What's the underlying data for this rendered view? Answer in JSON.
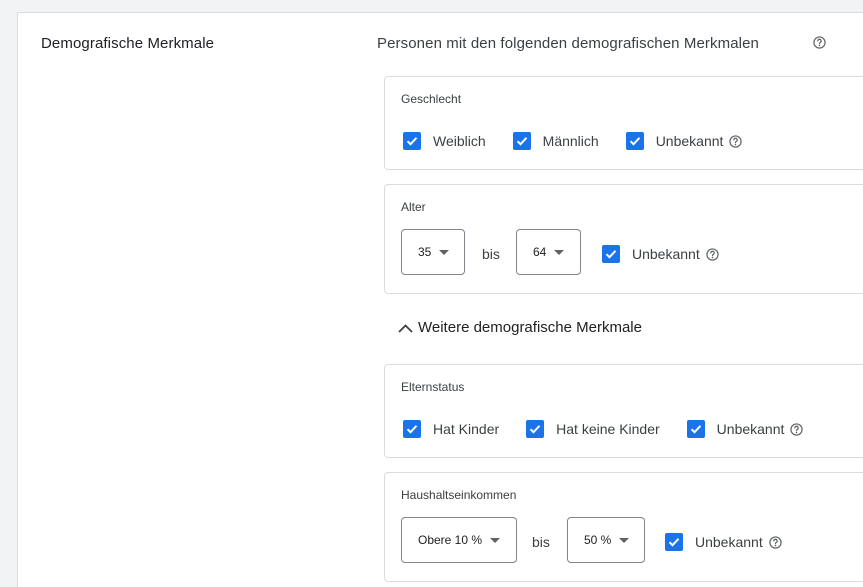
{
  "section_title": "Demografische Merkmale",
  "subtitle": "Personen mit den folgenden demografischen Merkmalen",
  "gender": {
    "label": "Geschlecht",
    "options": [
      {
        "label": "Weiblich",
        "checked": true
      },
      {
        "label": "Männlich",
        "checked": true
      },
      {
        "label": "Unbekannt",
        "checked": true
      }
    ]
  },
  "age": {
    "label": "Alter",
    "from": "35",
    "separator": "bis",
    "to": "64",
    "unknown_label": "Unbekannt",
    "unknown_checked": true
  },
  "more_demographics": {
    "label": "Weitere demografische Merkmale",
    "expanded": true
  },
  "parental_status": {
    "label": "Elternstatus",
    "options": [
      {
        "label": "Hat Kinder",
        "checked": true
      },
      {
        "label": "Hat keine Kinder",
        "checked": true
      },
      {
        "label": "Unbekannt",
        "checked": true
      }
    ]
  },
  "household_income": {
    "label": "Haushaltseinkommen",
    "from": "Obere 10 %",
    "separator": "bis",
    "to": "50 %",
    "unknown_label": "Unbekannt",
    "unknown_checked": true
  },
  "colors": {
    "checkbox": "#1a73e8",
    "border": "#dadce0",
    "text": "#3c4043"
  },
  "icons": {
    "help": "help-circle-icon",
    "dropdown": "dropdown-caret-icon",
    "collapse": "chevron-up-icon",
    "check": "check-icon"
  }
}
